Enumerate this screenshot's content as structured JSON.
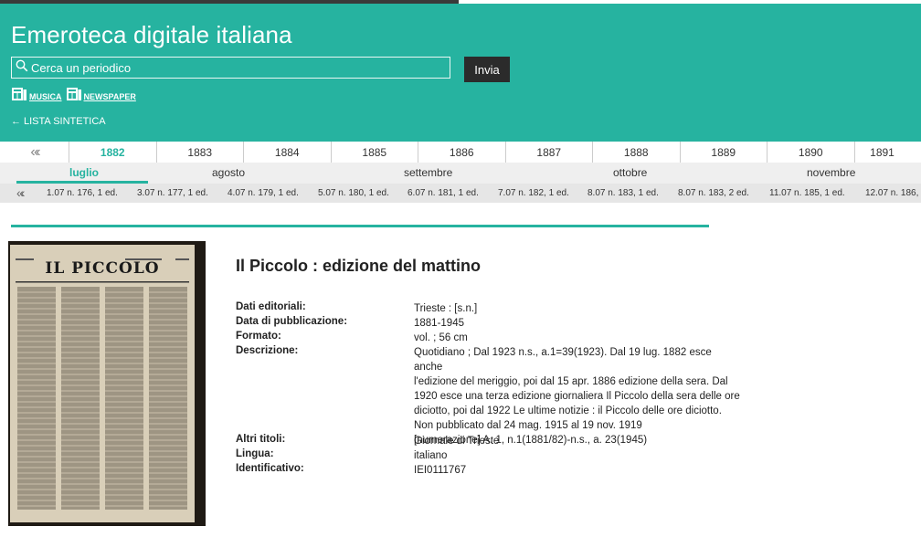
{
  "header": {
    "title": "Emeroteca digitale italiana",
    "search_placeholder": "Cerca un periodico",
    "submit_label": "Invia",
    "links": [
      "MUSICA",
      "NEWSPAPER"
    ],
    "back_link": "LISTA SINTETICA"
  },
  "colors": {
    "accent": "#26b3a0",
    "dark": "#2b2b2b"
  },
  "years": {
    "prev": "«‹",
    "items": [
      "1882",
      "1883",
      "1884",
      "1885",
      "1886",
      "1887",
      "1888",
      "1889",
      "1890",
      "1891"
    ],
    "selected": "1882"
  },
  "months": {
    "items": [
      "luglio",
      "agosto",
      "settembre",
      "ottobre",
      "novembre"
    ],
    "selected": "luglio"
  },
  "issues": {
    "prev": "«‹",
    "items": [
      "1.07 n. 176, 1 ed.",
      "3.07 n. 177, 1 ed.",
      "4.07 n. 179, 1 ed.",
      "5.07 n. 180, 1 ed.",
      "6.07 n. 181, 1 ed.",
      "7.07 n. 182, 1 ed.",
      "8.07 n. 183, 1 ed.",
      "8.07 n. 183, 2 ed.",
      "11.07 n. 185, 1 ed.",
      "12.07 n. 186,"
    ]
  },
  "record": {
    "title": "Il Piccolo : edizione del mattino",
    "image_masthead": "IL PICCOLO",
    "fields": {
      "dati_label": "Dati editoriali:",
      "dati_value": "Trieste : [s.n.]",
      "data_label": "Data di pubblicazione:",
      "data_value": "1881-1945",
      "formato_label": "Formato:",
      "formato_value": "vol. ; 56 cm",
      "descrizione_label": "Descrizione:",
      "descrizione_lines": [
        "Quotidiano ; Dal 1923 n.s., a.1=39(1923). Dal 19 lug. 1882 esce anche",
        "l'edizione del meriggio, poi dal 15 apr. 1886 edizione della sera. Dal",
        "1920 esce una terza edizione giornaliera Il Piccolo della sera delle ore",
        "diciotto, poi dal 1922 Le ultime notizie : il Piccolo delle ore diciotto.",
        "Non pubblicato dal 24 mag. 1915 al 19 nov. 1919",
        "[numerazione] A. 1, n.1(1881/82)-n.s., a. 23(1945)"
      ],
      "altri_label": "Altri titoli:",
      "altri_value": "Giornale di Trieste",
      "lingua_label": "Lingua:",
      "lingua_value": "italiano",
      "id_label": "Identificativo:",
      "id_value": "IEI0111767"
    }
  }
}
